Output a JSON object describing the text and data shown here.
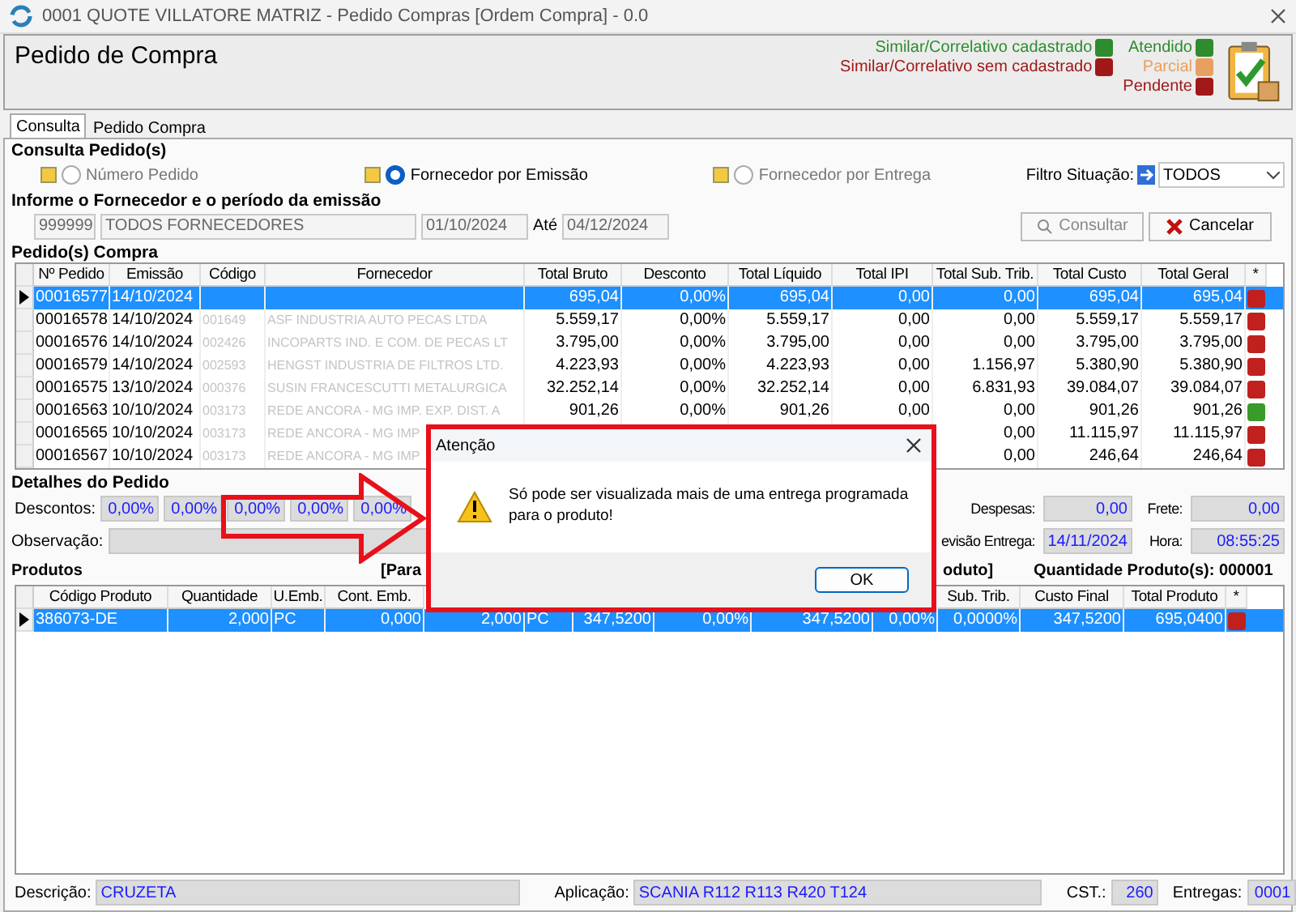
{
  "window": {
    "title": "0001 QUOTE VILLATORE MATRIZ - Pedido Compras [Ordem Compra] - 0.0"
  },
  "header": {
    "title": "Pedido de Compra",
    "legend_left": [
      {
        "label": "Similar/Correlativo cadastrado",
        "color": "#2e8b2e"
      },
      {
        "label": "Similar/Correlativo sem cadastrado",
        "color": "#a01818"
      }
    ],
    "legend_right": [
      {
        "label": "Atendido",
        "color": "#2e8b2e"
      },
      {
        "label": "Parcial",
        "color": "#e8a060"
      },
      {
        "label": "Pendente",
        "color": "#a01818"
      }
    ]
  },
  "tabs": [
    {
      "label": "Consulta",
      "selected": true
    },
    {
      "label": "Pedido Compra",
      "selected": false
    }
  ],
  "consulta": {
    "title": "Consulta Pedido(s)",
    "radios": [
      {
        "label": "Número Pedido",
        "selected": false
      },
      {
        "label": "Fornecedor por Emissão",
        "selected": true
      },
      {
        "label": "Fornecedor por Entrega",
        "selected": false
      }
    ],
    "filter_label": "Filtro Situação:",
    "filter_value": "TODOS",
    "period_title": "Informe o Fornecedor e o período da emissão",
    "supplier_code": "999999",
    "supplier_name": "TODOS FORNECEDORES",
    "date_from": "01/10/2024",
    "until_label": "Até",
    "date_to": "04/12/2024",
    "search_button": "Consultar",
    "cancel_button": "Cancelar"
  },
  "orders": {
    "title": "Pedido(s) Compra",
    "columns": [
      "Nº Pedido",
      "Emissão",
      "Código",
      "Fornecedor",
      "Total Bruto",
      "Desconto",
      "Total Líquido",
      "Total IPI",
      "Total Sub. Trib.",
      "Total Custo",
      "Total Geral",
      "*"
    ],
    "rows": [
      {
        "selected": true,
        "color": "#c0201e",
        "cells": [
          "00016577",
          "14/10/2024",
          null,
          null,
          "695,04",
          "0,00%",
          "695,04",
          "0,00",
          "0,00",
          "695,04",
          "695,04"
        ]
      },
      {
        "selected": false,
        "color": "#c0201e",
        "cells": [
          "00016578",
          "14/10/2024",
          "001649",
          "ASF INDUSTRIA AUTO PECAS LTDA",
          "5.559,17",
          "0,00%",
          "5.559,17",
          "0,00",
          "0,00",
          "5.559,17",
          "5.559,17"
        ]
      },
      {
        "selected": false,
        "color": "#c0201e",
        "cells": [
          "00016576",
          "14/10/2024",
          "002426",
          "INCOPARTS IND. E COM. DE PECAS LT",
          "3.795,00",
          "0,00%",
          "3.795,00",
          "0,00",
          "0,00",
          "3.795,00",
          "3.795,00"
        ]
      },
      {
        "selected": false,
        "color": "#c0201e",
        "cells": [
          "00016579",
          "14/10/2024",
          "002593",
          "HENGST INDUSTRIA DE FILTROS LTD.",
          "4.223,93",
          "0,00%",
          "4.223,93",
          "0,00",
          "1.156,97",
          "5.380,90",
          "5.380,90"
        ]
      },
      {
        "selected": false,
        "color": "#c0201e",
        "cells": [
          "00016575",
          "13/10/2024",
          "000376",
          "SUSIN FRANCESCUTTI METALURGICA",
          "32.252,14",
          "0,00%",
          "32.252,14",
          "0,00",
          "6.831,93",
          "39.084,07",
          "39.084,07"
        ]
      },
      {
        "selected": false,
        "color": "#3a9a2a",
        "cells": [
          "00016563",
          "10/10/2024",
          "003173",
          "REDE ANCORA - MG IMP.  EXP. DIST. A",
          "901,26",
          "0,00%",
          "901,26",
          "0,00",
          "0,00",
          "901,26",
          "901,26"
        ]
      },
      {
        "selected": false,
        "color": "#c0201e",
        "cells": [
          "00016565",
          "10/10/2024",
          "003173",
          "REDE ANCORA - MG IMP",
          null,
          null,
          null,
          null,
          "0,00",
          "11.115,97",
          "11.115,97"
        ]
      },
      {
        "selected": false,
        "color": "#c0201e",
        "cells": [
          "00016567",
          "10/10/2024",
          "003173",
          "REDE ANCORA - MG IMP",
          null,
          null,
          null,
          null,
          "0,00",
          "246,64",
          "246,64"
        ]
      }
    ]
  },
  "details": {
    "title": "Detalhes do Pedido",
    "discounts_label": "Descontos:",
    "discounts": [
      "0,00%",
      "0,00%",
      "0,00%",
      "0,00%",
      "0,00%"
    ],
    "observation_label": "Observação:",
    "expenses": {
      "label": "Despesas:",
      "value": "0,00"
    },
    "freight": {
      "label": "Frete:",
      "value": "0,00"
    },
    "delivery": {
      "label": "evisão Entrega:",
      "value": "14/11/2024"
    },
    "time": {
      "label": "Hora:",
      "value": "08:55:25"
    }
  },
  "products": {
    "title": "Produtos",
    "fragment_left": "[Para",
    "fragment_right": "oduto]",
    "count": "Quantidade Produto(s): 000001",
    "columns": [
      "Código Produto",
      "Quantidade",
      "U.Emb.",
      "Cont. Emb.",
      null,
      null,
      null,
      null,
      null,
      null,
      "Sub. Trib.",
      "Custo Final",
      "Total Produto",
      "*"
    ],
    "rows": [
      {
        "selected": true,
        "color": "#c0201e",
        "cells": [
          "386073-DE",
          "2,000",
          "PC",
          "0,000",
          "2,000",
          "PC",
          "347,5200",
          "0,00%",
          "347,5200",
          "0,00%",
          "0,0000%",
          "347,5200",
          "695,0400"
        ]
      }
    ]
  },
  "footer": [
    {
      "label": "Descrição:",
      "value": "CRUZETA"
    },
    {
      "label": "Aplicação:",
      "value": "SCANIA R112 R113 R420 T124"
    },
    {
      "label": "CST.:",
      "value": "260"
    },
    {
      "label": "Entregas:",
      "value": "0001"
    }
  ],
  "dialog": {
    "title": "Atenção",
    "message": "Só pode ser visualizada mais de uma entrega programada para o produto!",
    "button": "OK"
  }
}
